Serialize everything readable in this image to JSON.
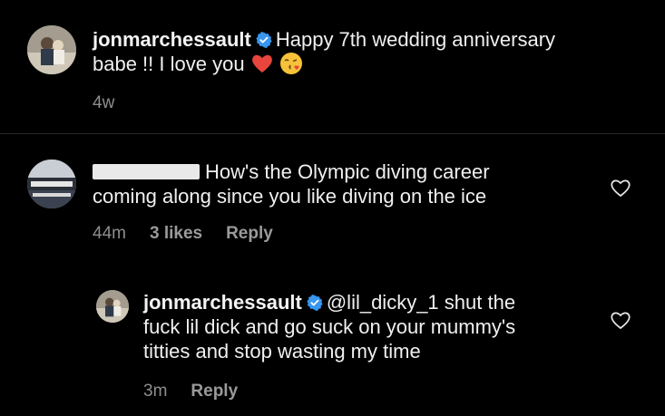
{
  "caption": {
    "username": "jonmarchessault",
    "text_line1": "Happy 7th wedding anniversary",
    "text_line2": "babe !! I love you",
    "time": "4w",
    "emojis": [
      "red-heart",
      "face-blowing-kiss"
    ]
  },
  "comment": {
    "username_redacted": true,
    "text_line1": "How's the Olympic diving career",
    "text_line2": "coming along since you like diving on the ice",
    "time": "44m",
    "likes": "3 likes",
    "reply_label": "Reply"
  },
  "reply": {
    "username": "jonmarchessault",
    "mention": "@lil_dicky_1",
    "text_line1_rest": " shut the",
    "text_line2": "fuck lil dick and go suck on your mummy's",
    "text_line3": "titties and stop wasting my time",
    "time": "3m",
    "reply_label": "Reply"
  },
  "colors": {
    "background": "#000000",
    "verified_badge": "#3897f0",
    "meta_text": "#8e8e8e",
    "heart_emoji": "#e8453c"
  }
}
